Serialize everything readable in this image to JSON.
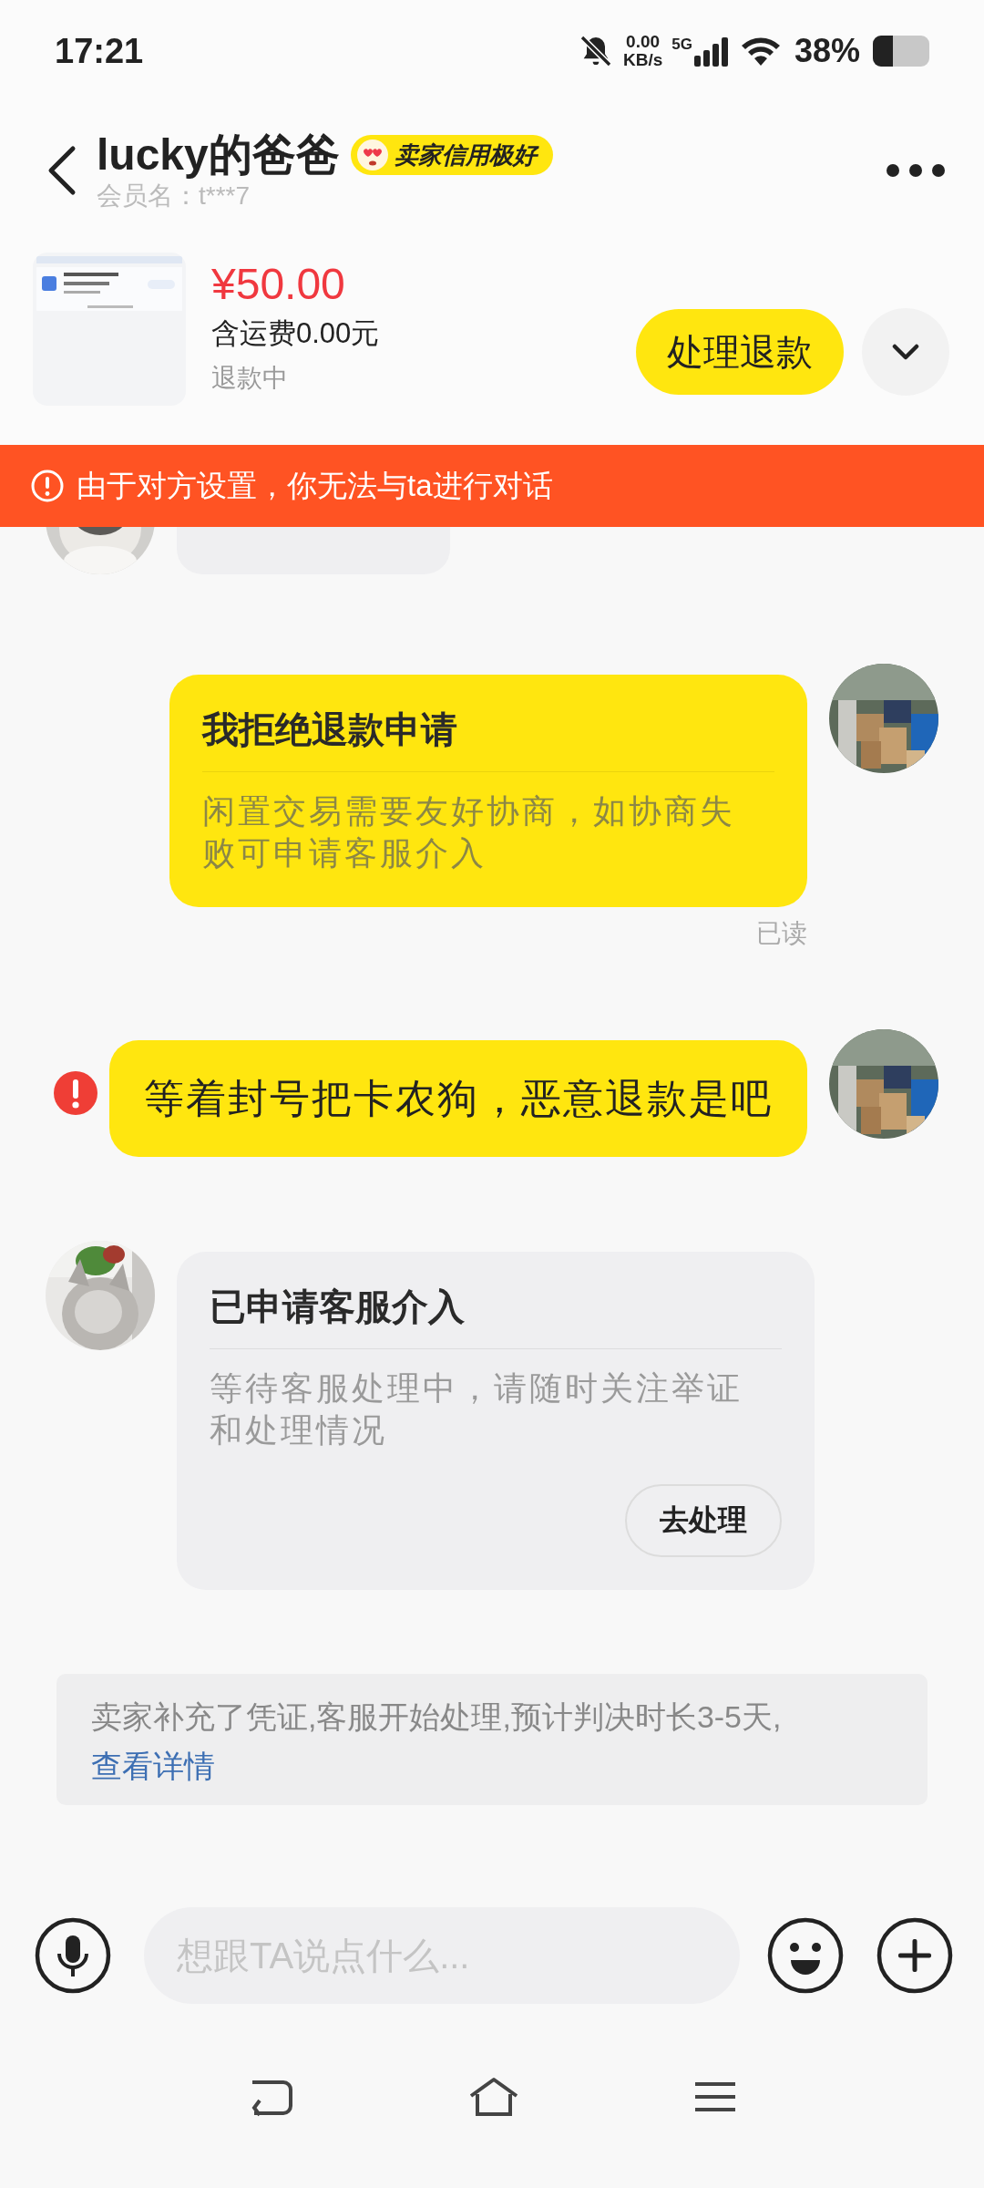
{
  "status_bar": {
    "time": "17:21",
    "net_speed": "0.00",
    "net_unit": "KB/s",
    "network": "5G",
    "battery": "38%"
  },
  "header": {
    "title": "lucky的爸爸",
    "badge": "卖家信用极好",
    "member": "会员名：t***7"
  },
  "product": {
    "price": "¥50.00",
    "shipping": "含运费0.00元",
    "status": "退款中",
    "action": "处理退款"
  },
  "notice": {
    "text": "由于对方设置，你无法与ta进行对话"
  },
  "messages": [
    {
      "kind": "partial",
      "outgoing": false
    },
    {
      "kind": "card",
      "outgoing": true,
      "title": "我拒绝退款申请",
      "body": "闲置交易需要友好协商，如协商失败可申请客服介入",
      "receipt": "已读"
    },
    {
      "kind": "text",
      "outgoing": true,
      "text": "等着封号把卡农狗，恶意退款是吧",
      "failed": true
    },
    {
      "kind": "card",
      "outgoing": false,
      "title": "已申请客服介入",
      "body": "等待客服处理中，请随时关注举证和处理情况",
      "button": "去处理"
    },
    {
      "kind": "system",
      "text": "卖家补充了凭证,客服开始处理,预计判决时长3-5天,",
      "link": "查看详情"
    }
  ],
  "input": {
    "placeholder": "想跟TA说点什么..."
  }
}
